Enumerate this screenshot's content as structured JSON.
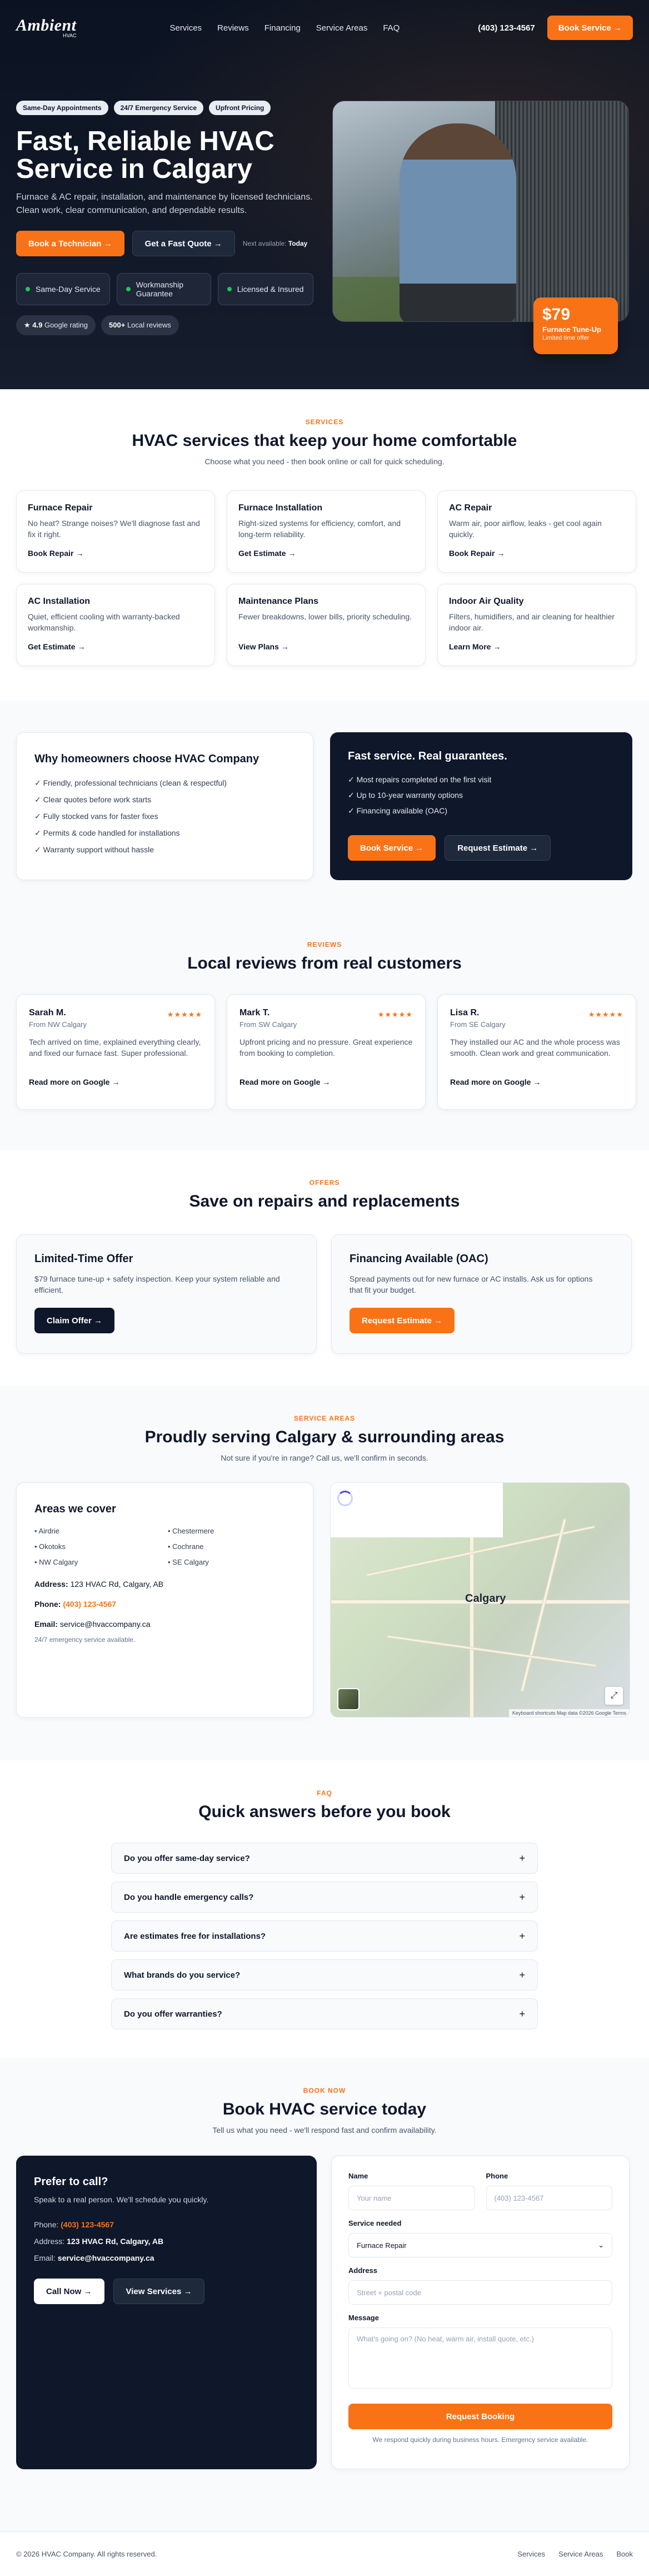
{
  "brand": {
    "name": "Ambient",
    "sub": "HVAC"
  },
  "nav": {
    "links": [
      "Services",
      "Reviews",
      "Financing",
      "Service Areas",
      "FAQ"
    ],
    "phone": "(403) 123-4567",
    "cta": "Book Service →"
  },
  "hero": {
    "pills": [
      "Same-Day Appointments",
      "24/7 Emergency Service",
      "Upfront Pricing"
    ],
    "title": "Fast, Reliable HVAC Service in Calgary",
    "subtitle": "Furnace & AC repair, installation, and maintenance by licensed technicians. Clean work, clear communication, and dependable results.",
    "cta_primary": "Book a Technician →",
    "cta_secondary": "Get a Fast Quote →",
    "next_label": "Next available:",
    "next_value": "Today",
    "features": [
      "Same-Day Service",
      "Workmanship Guarantee",
      "Licensed & Insured"
    ],
    "rating_value": "★ 4.9",
    "rating_label": "Google rating",
    "reviews_value": "500+",
    "reviews_label": "Local reviews",
    "price": "$79",
    "price_title": "Furnace Tune-Up",
    "price_note": "Limited time offer"
  },
  "services": {
    "eyebrow": "SERVICES",
    "title": "HVAC services that keep your home comfortable",
    "subtitle": "Choose what you need - then book online or call for quick scheduling.",
    "items": [
      {
        "title": "Furnace Repair",
        "desc": "No heat? Strange noises? We'll diagnose fast and fix it right.",
        "link": "Book Repair →"
      },
      {
        "title": "Furnace Installation",
        "desc": "Right-sized systems for efficiency, comfort, and long-term reliability.",
        "link": "Get Estimate →"
      },
      {
        "title": "AC Repair",
        "desc": "Warm air, poor airflow, leaks - get cool again quickly.",
        "link": "Book Repair →"
      },
      {
        "title": "AC Installation",
        "desc": "Quiet, efficient cooling with warranty-backed workmanship.",
        "link": "Get Estimate →"
      },
      {
        "title": "Maintenance Plans",
        "desc": "Fewer breakdowns, lower bills, priority scheduling.",
        "link": "View Plans →"
      },
      {
        "title": "Indoor Air Quality",
        "desc": "Filters, humidifiers, and air cleaning for healthier indoor air.",
        "link": "Learn More →"
      }
    ]
  },
  "why": {
    "title": "Why homeowners choose HVAC Company",
    "items": [
      "✓ Friendly, professional technicians (clean & respectful)",
      "✓ Clear quotes before work starts",
      "✓ Fully stocked vans for faster fixes",
      "✓ Permits & code handled for installations",
      "✓ Warranty support without hassle"
    ],
    "right_title": "Fast service. Real guarantees.",
    "right_items": [
      "✓ Most repairs completed on the first visit",
      "✓ Up to 10-year warranty options",
      "✓ Financing available (OAC)"
    ],
    "btn_primary": "Book Service →",
    "btn_secondary": "Request Estimate →"
  },
  "reviews": {
    "eyebrow": "REVIEWS",
    "title": "Local reviews from real customers",
    "items": [
      {
        "name": "Sarah M.",
        "from": "From NW Calgary",
        "stars": "★★★★★",
        "text": "Tech arrived on time, explained everything clearly, and fixed our furnace fast. Super professional.",
        "link": "Read more on Google →"
      },
      {
        "name": "Mark T.",
        "from": "From SW Calgary",
        "stars": "★★★★★",
        "text": "Upfront pricing and no pressure. Great experience from booking to completion.",
        "link": "Read more on Google →"
      },
      {
        "name": "Lisa R.",
        "from": "From SE Calgary",
        "stars": "★★★★★",
        "text": "They installed our AC and the whole process was smooth. Clean work and great communication.",
        "link": "Read more on Google →"
      }
    ]
  },
  "offers": {
    "eyebrow": "OFFERS",
    "title": "Save on repairs and replacements",
    "items": [
      {
        "title": "Limited-Time Offer",
        "desc": "$79 furnace tune-up + safety inspection. Keep your system reliable and efficient.",
        "btn": "Claim Offer →"
      },
      {
        "title": "Financing Available (OAC)",
        "desc": "Spread payments out for new furnace or AC installs. Ask us for options that fit your budget.",
        "btn": "Request Estimate →"
      }
    ]
  },
  "areas": {
    "eyebrow": "SERVICE AREAS",
    "title": "Proudly serving Calgary & surrounding areas",
    "subtitle": "Not sure if you're in range? Call us, we'll confirm in seconds.",
    "box_title": "Areas we cover",
    "col1": [
      "• Airdrie",
      "• Okotoks",
      "• NW Calgary"
    ],
    "col2": [
      "• Chestermere",
      "• Cochrane",
      "• SE Calgary"
    ],
    "address_label": "Address:",
    "address": "123 HVAC Rd, Calgary, AB",
    "phone_label": "Phone:",
    "phone": "(403) 123-4567",
    "email_label": "Email:",
    "email": "service@hvaccompany.ca",
    "note": "24/7 emergency service available.",
    "map_city": "Calgary",
    "map_credit": "Keyboard shortcuts   Map data ©2026 Google   Terms"
  },
  "faq": {
    "eyebrow": "FAQ",
    "title": "Quick answers before you book",
    "items": [
      "Do you offer same-day service?",
      "Do you handle emergency calls?",
      "Are estimates free for installations?",
      "What brands do you service?",
      "Do you offer warranties?"
    ]
  },
  "book": {
    "eyebrow": "BOOK NOW",
    "title": "Book HVAC service today",
    "subtitle": "Tell us what you need - we'll respond fast and confirm availability.",
    "left_title": "Prefer to call?",
    "left_sub": "Speak to a real person. We'll schedule you quickly.",
    "phone_label": "Phone:",
    "phone": "(403) 123-4567",
    "address_label": "Address:",
    "address": "123 HVAC Rd, Calgary, AB",
    "email_label": "Email:",
    "email": "service@hvaccompany.ca",
    "btn_call": "Call Now →",
    "btn_services": "View Services →",
    "form": {
      "name_label": "Name",
      "name_placeholder": "Your name",
      "phone_label": "Phone",
      "phone_placeholder": "(403) 123-4567",
      "service_label": "Service needed",
      "service_value": "Furnace Repair",
      "address_label": "Address",
      "address_placeholder": "Street + postal code",
      "message_label": "Message",
      "message_placeholder": "What's going on? (No heat, warm air, install quote, etc.)",
      "submit": "Request Booking",
      "fine": "We respond quickly during business hours. Emergency service available."
    }
  },
  "footer": {
    "copyright": "© 2026 HVAC Company. All rights reserved.",
    "links": [
      "Services",
      "Service Areas",
      "Book"
    ]
  },
  "colors": {
    "accent": "#f97316",
    "navy": "#0f172a",
    "hero_bg": "#111827"
  }
}
